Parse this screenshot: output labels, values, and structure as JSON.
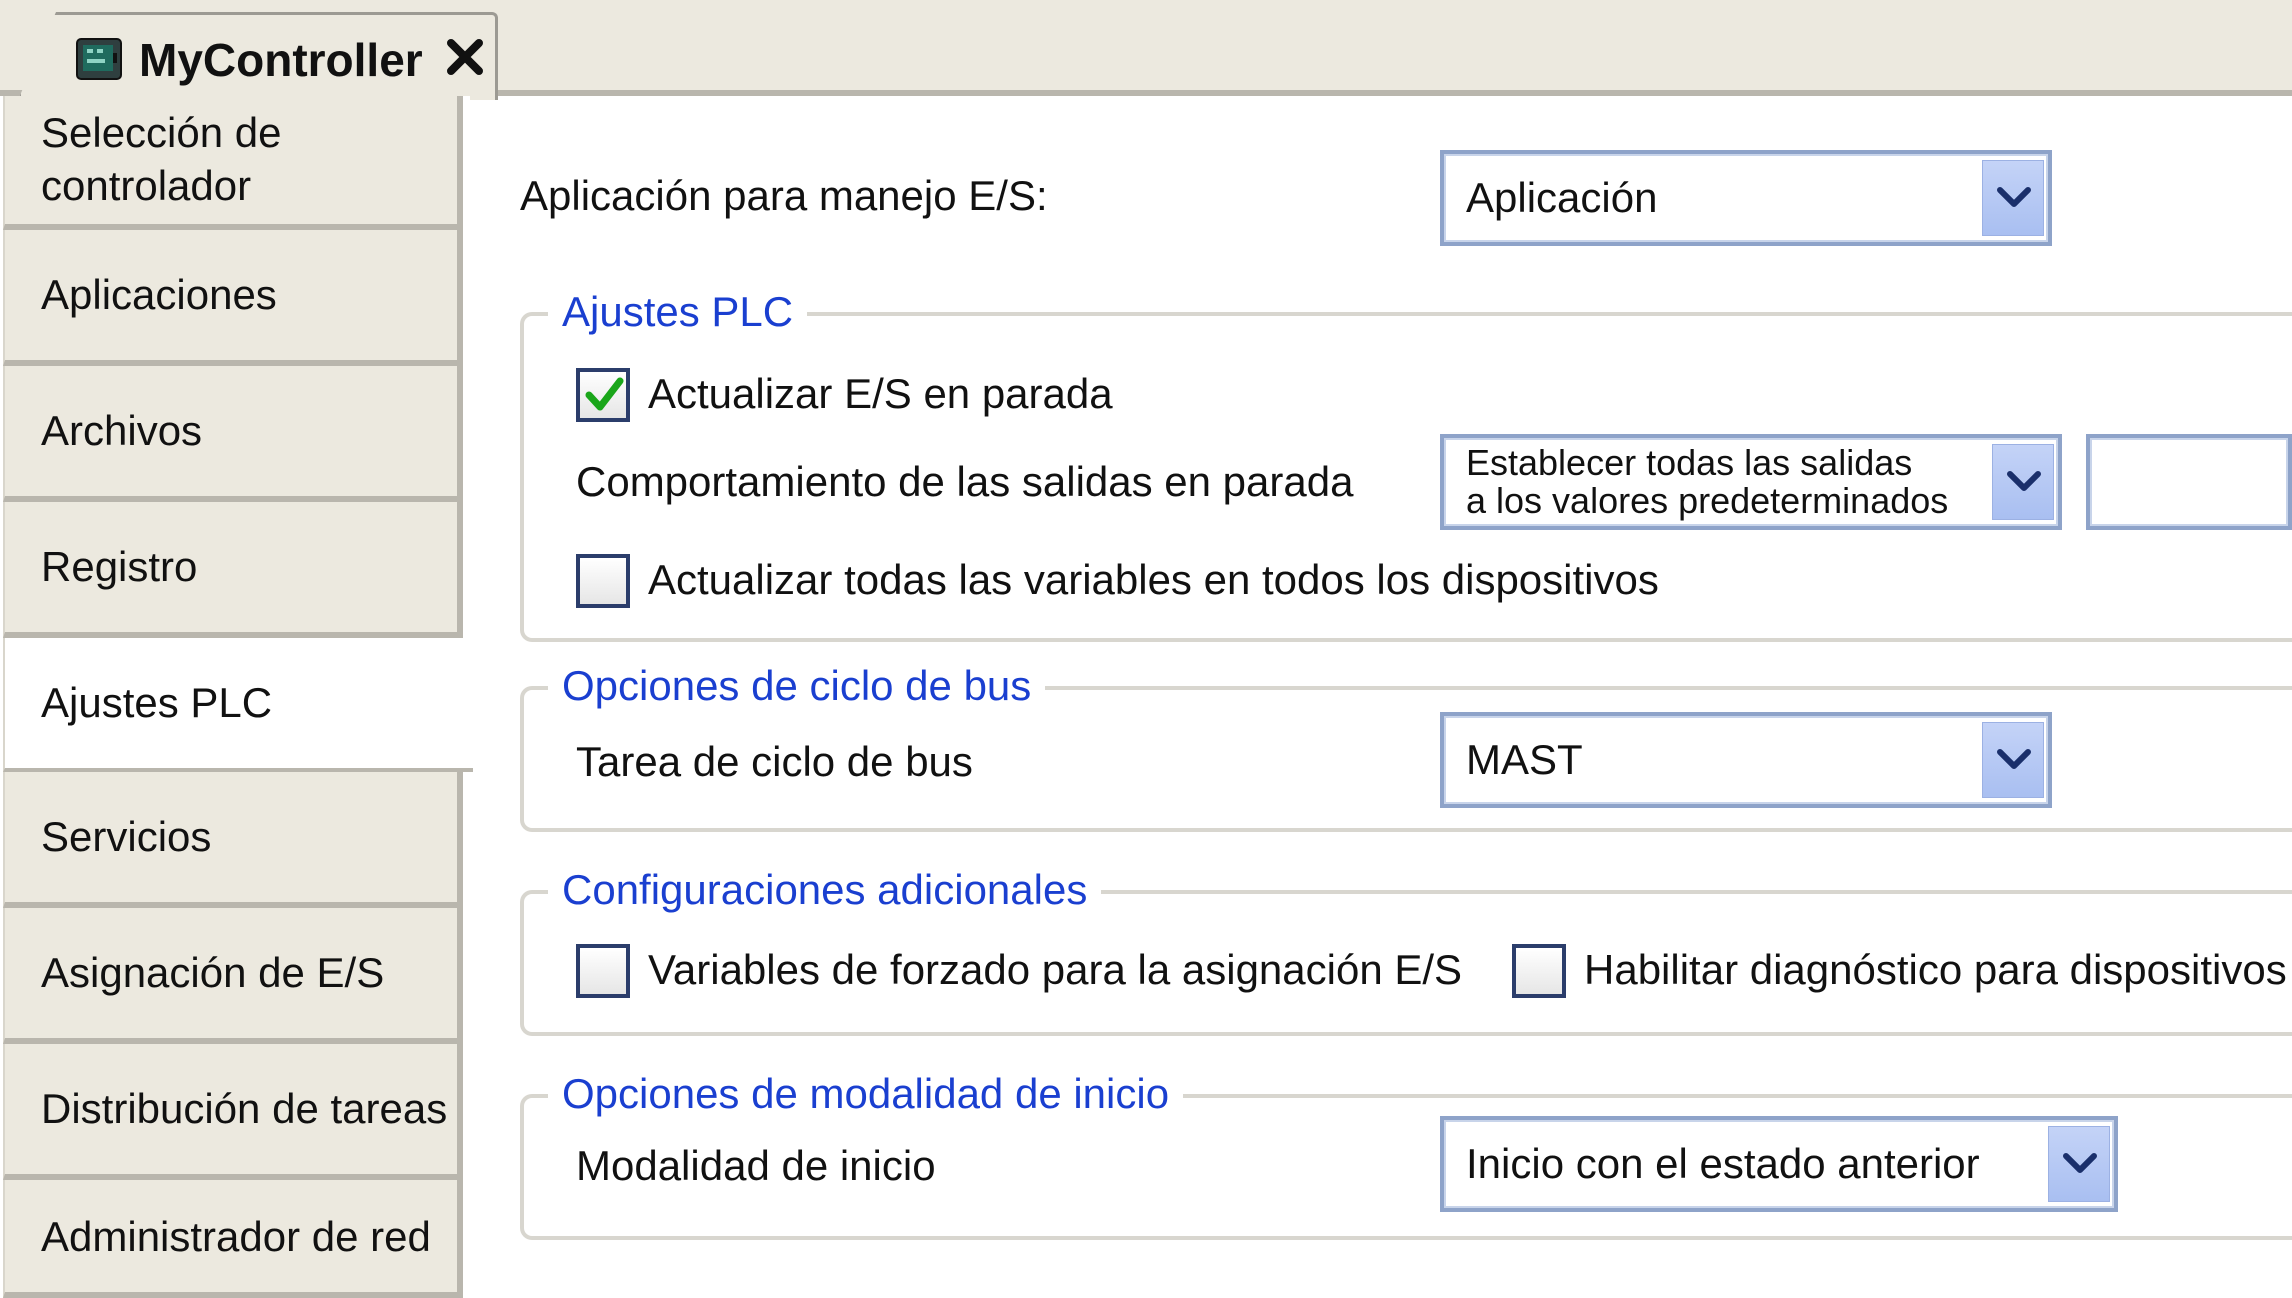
{
  "tab": {
    "title": "MyController",
    "icon": "controller-icon",
    "close_icon": "close-icon"
  },
  "sidebar": {
    "items": [
      {
        "label": "Selección de\ncontrolador",
        "active": false
      },
      {
        "label": "Aplicaciones",
        "active": false
      },
      {
        "label": "Archivos",
        "active": false
      },
      {
        "label": "Registro",
        "active": false
      },
      {
        "label": "Ajustes PLC",
        "active": true
      },
      {
        "label": "Servicios",
        "active": false
      },
      {
        "label": "Asignación de E/S",
        "active": false
      },
      {
        "label": "Distribución de tareas",
        "active": false
      },
      {
        "label": "Administrador de red",
        "active": false
      }
    ]
  },
  "main": {
    "io_app": {
      "label": "Aplicación para manejo E/S:",
      "value": "Aplicación"
    },
    "plc_settings": {
      "title": "Ajustes PLC",
      "update_io_stop": {
        "label": "Actualizar E/S en parada",
        "checked": true
      },
      "outputs_behavior": {
        "label": "Comportamiento de las salidas en parada",
        "value_line1": "Establecer todas las salidas",
        "value_line2": "a los valores predeterminados"
      },
      "update_all_vars": {
        "label": "Actualizar todas las variables en todos los dispositivos",
        "checked": false
      }
    },
    "bus_cycle": {
      "title": "Opciones de ciclo de bus",
      "task_label": "Tarea de ciclo de bus",
      "task_value": "MAST"
    },
    "additional": {
      "title": "Configuraciones adicionales",
      "force_vars": {
        "label": "Variables de forzado para la asignación E/S",
        "checked": false
      },
      "diagnostics": {
        "label": "Habilitar diagnóstico para dispositivos",
        "checked": false
      }
    },
    "startup": {
      "title": "Opciones de modalidad de inicio",
      "mode_label": "Modalidad de inicio",
      "mode_value": "Inicio con el estado anterior"
    }
  },
  "colors": {
    "group_title": "#1a3fd0",
    "check_mark": "#1aa61a",
    "panel_bg": "#ece9df",
    "combo_border": "#8ea3c9"
  }
}
